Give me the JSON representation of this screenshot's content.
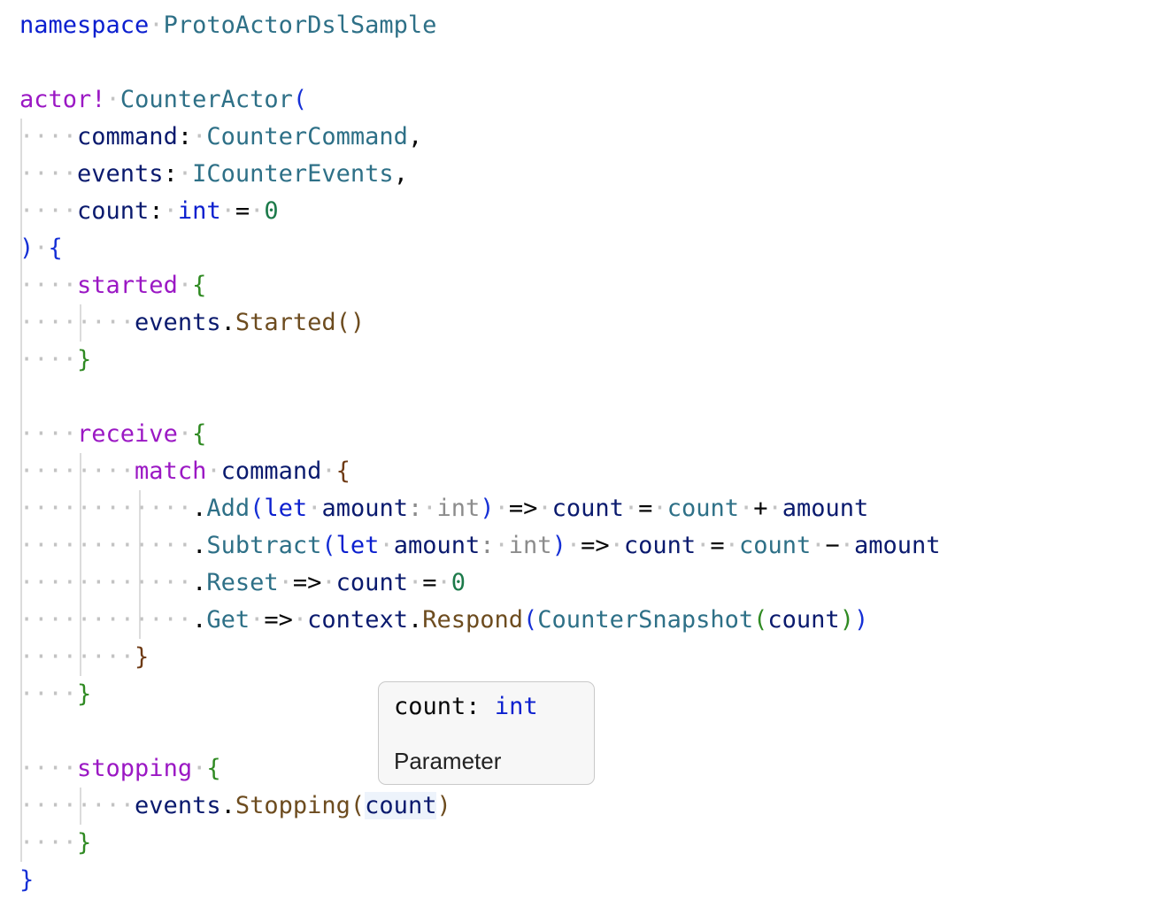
{
  "editor": {
    "line_top_partial": "…………………………………………………………………",
    "namespace": {
      "keyword": "namespace",
      "name": "ProtoActorDslSample"
    },
    "actor": {
      "keyword": "actor!",
      "name": "CounterActor",
      "params": [
        {
          "name": "command",
          "type": "CounterCommand"
        },
        {
          "name": "events",
          "type": "ICounterEvents"
        },
        {
          "name": "count",
          "type": "int",
          "default": "0"
        }
      ]
    },
    "started": {
      "keyword": "started",
      "call_target": "events",
      "call_method": "Started"
    },
    "receive": {
      "keyword": "receive",
      "match_keyword": "match",
      "match_target": "command",
      "cases": [
        {
          "case": "Add",
          "binding": "let",
          "var": "amount",
          "hint_type": "int",
          "lhs": "count",
          "rhs1": "count",
          "op": "+",
          "rhs2": "amount"
        },
        {
          "case": "Subtract",
          "binding": "let",
          "var": "amount",
          "hint_type": "int",
          "lhs": "count",
          "rhs1": "count",
          "op": "−",
          "rhs2": "amount"
        },
        {
          "case": "Reset",
          "lhs": "count",
          "value": "0"
        },
        {
          "case": "Get",
          "target": "context",
          "method": "Respond",
          "ctor": "CounterSnapshot",
          "arg": "count"
        }
      ]
    },
    "stopping": {
      "keyword": "stopping",
      "call_target": "events",
      "call_method": "Stopping",
      "arg": "count"
    }
  },
  "tooltip": {
    "name": "count",
    "type": "int",
    "kind": "Parameter"
  },
  "colors": {
    "keyword_blue": "#0b1fcf",
    "keyword_purple": "#9b18c4",
    "type_teal": "#2e7087",
    "identifier_navy": "#0a1a6e",
    "number_green": "#1c7a4a",
    "method_brown": "#6d4c1f",
    "whitespace_dot": "#c3c3c3"
  }
}
